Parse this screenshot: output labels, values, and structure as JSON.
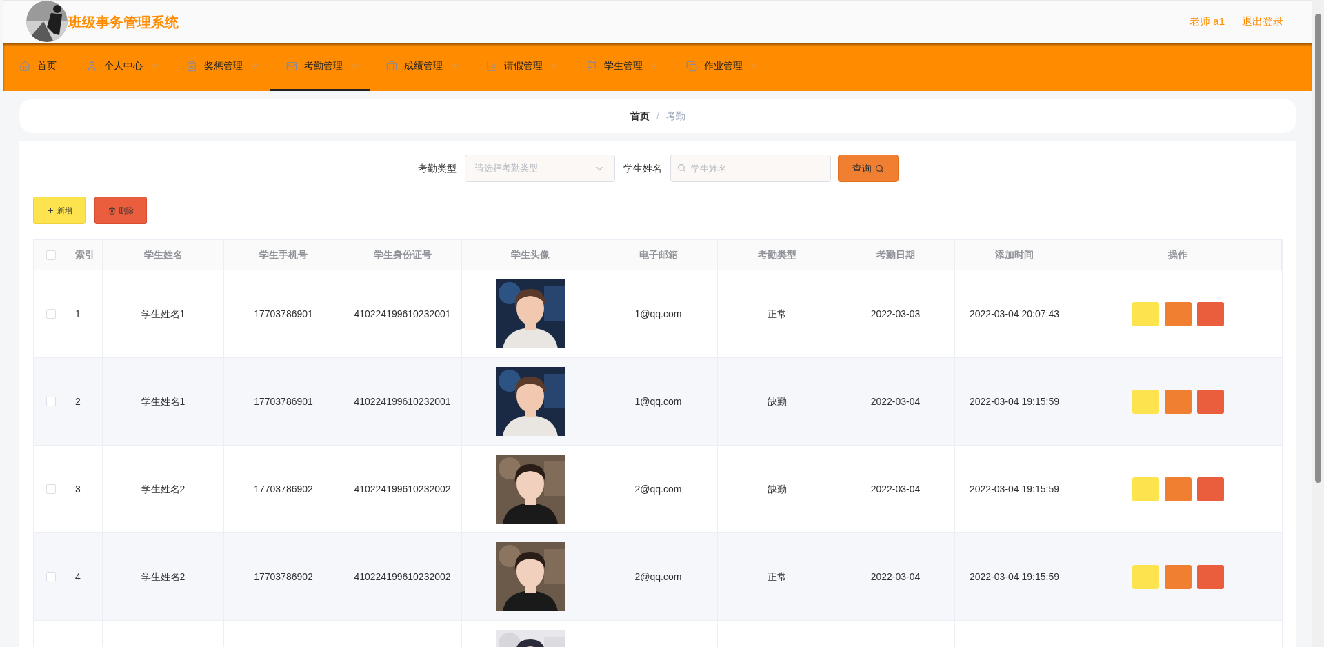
{
  "header": {
    "logo": {
      "kind": "picture"
    },
    "title": "班级事务管理系统",
    "user": "老师 a1",
    "logout": "退出登录"
  },
  "nav": [
    {
      "label": "首页",
      "dropdown": false,
      "selected": false
    },
    {
      "label": "个人中心",
      "dropdown": true,
      "selected": false
    },
    {
      "label": "奖惩管理",
      "dropdown": true,
      "selected": false
    },
    {
      "label": "考勤管理",
      "dropdown": true,
      "selected": true
    },
    {
      "label": "成绩管理",
      "dropdown": true,
      "selected": false
    },
    {
      "label": "请假管理",
      "dropdown": true,
      "selected": false
    },
    {
      "label": "学生管理",
      "dropdown": true,
      "selected": false
    },
    {
      "label": "作业管理",
      "dropdown": true,
      "selected": false
    }
  ],
  "breadcrumb": [
    {
      "label": "首页",
      "selected": false
    },
    {
      "label": "考勤",
      "selected": true
    }
  ],
  "separator": "/",
  "search": {
    "type_label": "考勤类型",
    "type_placeholder": "请选择考勤类型",
    "name_label": "学生姓名",
    "name_placeholder": "学生姓名",
    "query_button": "查询"
  },
  "actions": [
    {
      "label": "新增",
      "kind": "add"
    },
    {
      "label": "删除",
      "kind": "delete"
    }
  ],
  "table": {
    "select_all": {
      "checked": false
    },
    "columns": [
      "索引",
      "学生姓名",
      "学生手机号",
      "学生身份证号",
      "学生头像",
      "电子邮箱",
      "考勤类型",
      "考勤日期",
      "添加时间",
      "操作"
    ],
    "rows": [
      {
        "checked": false,
        "index": "1",
        "name": "学生姓名1",
        "phone": "17703786901",
        "id_number": "410224199610232001",
        "avatar": {
          "kind": "picture"
        },
        "email": "1@qq.com",
        "type": "正常",
        "date": "2022-03-03",
        "added": "2022-03-04 20:07:43"
      },
      {
        "checked": false,
        "index": "2",
        "name": "学生姓名1",
        "phone": "17703786901",
        "id_number": "410224199610232001",
        "avatar": {
          "kind": "picture"
        },
        "email": "1@qq.com",
        "type": "缺勤",
        "date": "2022-03-04",
        "added": "2022-03-04 19:15:59"
      },
      {
        "checked": false,
        "index": "3",
        "name": "学生姓名2",
        "phone": "17703786902",
        "id_number": "410224199610232002",
        "avatar": {
          "kind": "picture"
        },
        "email": "2@qq.com",
        "type": "缺勤",
        "date": "2022-03-04",
        "added": "2022-03-04 19:15:59"
      },
      {
        "checked": false,
        "index": "4",
        "name": "学生姓名2",
        "phone": "17703786902",
        "id_number": "410224199610232002",
        "avatar": {
          "kind": "picture"
        },
        "email": "2@qq.com",
        "type": "正常",
        "date": "2022-03-04",
        "added": "2022-03-04 19:15:59"
      },
      {
        "avatar": {
          "kind": "picture"
        }
      }
    ],
    "row_buttons": [
      {
        "kind": "edit"
      },
      {
        "kind": "detail"
      },
      {
        "kind": "delete"
      }
    ]
  }
}
